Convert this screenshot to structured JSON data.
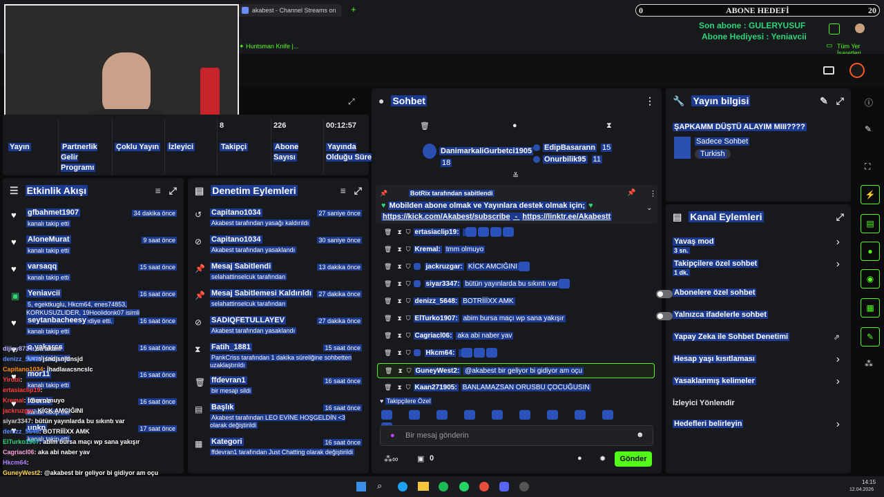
{
  "browser": {
    "tab_title": "akabest - Channel Streams on",
    "new_tab": "+",
    "bookmark": "Huntsman Knife |...",
    "all_bookmarks": "Tüm Yer İşaretleri"
  },
  "overlay": {
    "goal_left": "0",
    "goal_title": "ABONE HEDEFİ",
    "goal_right": "20",
    "last_sub": "Son abone : GULERYUSUF",
    "sub_gifter": "Abone Hediyesi : Yeniavcii"
  },
  "stats": {
    "items": [
      {
        "label": "Yayın",
        "value": ""
      },
      {
        "label": "Partnerlik Gelir Programı",
        "value": ""
      },
      {
        "label": "Çoklu Yayın",
        "value": ""
      },
      {
        "label": "İzleyici",
        "value": ""
      },
      {
        "label": "Takipçi",
        "value": "8"
      },
      {
        "label": "Abone Sayısı",
        "value": "226"
      },
      {
        "label": "Yayında Olduğu Süre",
        "value": "00:12:57"
      }
    ]
  },
  "activity": {
    "title": "Etkinlik Akışı",
    "items": [
      {
        "user": "gfbahmet1907",
        "desc": "kanalı takip etti",
        "time": "34 dakika önce"
      },
      {
        "user": "AloneMurat",
        "desc": "kanalı takip etti",
        "time": "9 saat önce"
      },
      {
        "user": "varsaqq",
        "desc": "kanalı takip etti",
        "time": "15 saat önce"
      },
      {
        "user": "Yeniavcii",
        "desc": "5, egektkuglu, Hkcm64, enes74853, KORKUSUZLIDER, 19Hoolidonk07 isimli kullanıcıya abonelik hediye etti.",
        "time": "16 saat önce"
      },
      {
        "user": "seytanbacheesy",
        "desc": "kanalı takip etti",
        "time": "16 saat önce"
      },
      {
        "user": "o.yakarcs",
        "desc": "kanalı takip etti",
        "time": "16 saat önce"
      },
      {
        "user": "mor11",
        "desc": "kanalı takip etti",
        "time": "16 saat önce"
      },
      {
        "user": "iGeme",
        "desc": "kanalı takip etti",
        "time": "16 saat önce"
      },
      {
        "user": "unkn",
        "desc": "kanalı takip etti",
        "time": "17 saat önce"
      }
    ]
  },
  "overlay_chat": [
    {
      "user": "dijiey8734",
      "msg": ": sa akam",
      "color": "#b7b7ff"
    },
    {
      "user": "denizz_5648",
      "msg": ": jsndjsnjdnsjd",
      "color": "#5b8cff"
    },
    {
      "user": "Capitano1034",
      "msg": ": İhadlaıacsncslc",
      "color": "#ff8a00"
    },
    {
      "user": "Yirobi",
      "msg": ":",
      "color": "#ff3b3b"
    },
    {
      "user": "ertasiaclip19",
      "msg": ":",
      "color": "#ff3b3b"
    },
    {
      "user": "Kremal",
      "msg": ": tmm olmuyo",
      "color": "#ff3b3b"
    },
    {
      "user": "jackruzgar",
      "msg": ": KİCK AMCIĞINI",
      "color": "#ff3b3b"
    },
    {
      "user": "siyar3347",
      "msg": ": bütün yayınlarda bu sıkıntı var",
      "color": "#cfcfcf"
    },
    {
      "user": "denizz_5648",
      "msg": ": BOTRİİİXX AMK",
      "color": "#5b8cff"
    },
    {
      "user": "ElTurko1907",
      "msg": ": abim bursa maçı wp sana yakışır",
      "color": "#2ed67a"
    },
    {
      "user": "Cagriacl06",
      "msg": ": aka abi naber yav",
      "color": "#ff9edb"
    },
    {
      "user": "Hkcm64",
      "msg": ":",
      "color": "#b07cff"
    },
    {
      "user": "GuneyWest2",
      "msg": ": @akabest bir geliyor bi gidiyor am oçu",
      "color": "#ffd54a"
    },
    {
      "user": "Kaan271905",
      "msg": ": BANLAMAZSAN ORUSBU ÇOCUĞUSIN",
      "color": "#ffffff"
    }
  ],
  "moderation": {
    "title": "Denetim Eylemleri",
    "items": [
      {
        "title": "Capitano1034",
        "desc": "Akabest tarafından yasağı kaldırıldı",
        "time": "27 saniye önce",
        "icon": "undo-icon"
      },
      {
        "title": "Capitano1034",
        "desc": "Akabest tarafından yasaklandı",
        "time": "30 saniye önce",
        "icon": "ban-icon"
      },
      {
        "title": "Mesaj Sabitlendi",
        "desc": "selahattinselcuk tarafından",
        "time": "13 dakika önce",
        "icon": "pin-icon"
      },
      {
        "title": "Mesaj Sabitlemesi Kaldırıldı",
        "desc": "selahattinselcuk tarafından",
        "time": "27 dakika önce",
        "icon": "unpin-icon"
      },
      {
        "title": "SADIQFETULLAYEV",
        "desc": "Akabest tarafından yasaklandı",
        "time": "27 dakika önce",
        "icon": "ban-icon"
      },
      {
        "title": "Fatih_1881",
        "desc": "PankCriss tarafından 1 dakika süreliğine sohbetten uzaklaştırıldı",
        "time": "15 saat önce",
        "icon": "hourglass-icon"
      },
      {
        "title": "ffdevran1",
        "desc": "bir mesajı sildi",
        "time": "16 saat önce",
        "icon": "trash-icon"
      },
      {
        "title": "Başlık",
        "desc": "Akabest tarafından LEO EVİNE HOŞGELDİN <3 olarak değiştirildi",
        "time": "16 saat önce",
        "icon": "title-icon"
      },
      {
        "title": "Kategori",
        "desc": "ffdevran1 tarafından Just Chatting olarak değiştirildi",
        "time": "16 saat önce",
        "icon": "category-icon"
      }
    ]
  },
  "chat": {
    "title": "Sohbet",
    "top_users": [
      {
        "name": "DanimarkaliGurbetci1905",
        "count": "18"
      },
      {
        "name": "EdipBasarann",
        "count": "15"
      },
      {
        "name": "Onurbilik95",
        "count": "11"
      }
    ],
    "pinned": {
      "by": "BotRix tarafından sabitlendi",
      "text": "Mobilden abone olmak ve Yayınlara destek olmak için;",
      "link1": "https://kick.com/Akabest/subscribe",
      "sep": " - ",
      "link2": "https://linktr.ee/Akabestt"
    },
    "messages": [
      {
        "user": "ertasiaclip19:",
        "msg": "",
        "emotes": 4
      },
      {
        "user": "Kremal:",
        "msg": "tmm olmuyo",
        "emotes": 0
      },
      {
        "user": "jackruzgar:",
        "msg": "KİCK AMCIĞINI",
        "emotes": 1
      },
      {
        "user": "siyar3347:",
        "msg": "bütün yayınlarda bu sıkıntı var",
        "emotes": 1
      },
      {
        "user": "denizz_5648:",
        "msg": "BOTRİİİXX AMK",
        "emotes": 0
      },
      {
        "user": "ElTurko1907:",
        "msg": "abim bursa maçı wp sana yakışır",
        "emotes": 0
      },
      {
        "user": "Cagriacl06:",
        "msg": "aka abi naber yav",
        "emotes": 0
      },
      {
        "user": "Hkcm64:",
        "msg": "",
        "emotes": 3
      },
      {
        "user": "GuneyWest2:",
        "msg": "@akabest bir geliyor bi gidiyor am oçu",
        "emotes": 0
      },
      {
        "user": "Kaan271905:",
        "msg": "BANLAMAZSAN ORUSBU ÇOCUĞUSIN",
        "emotes": 0
      }
    ],
    "followers_only": "Takipçilere Özel",
    "input_placeholder": "Bir mesaj gönderin",
    "points": "0",
    "send": "Gönder"
  },
  "stream_info": {
    "title": "Yayın bilgisi",
    "stream_title": "ŞAPKAMM DÜŞTÜ ALAYIM MIII????",
    "category": "Sadece Sohbet",
    "language": "Turkish"
  },
  "channel_actions": {
    "title": "Kanal Eylemleri",
    "items": [
      {
        "label": "Yavaş mod",
        "sub": "3 sn.",
        "ctrl": "chevron"
      },
      {
        "label": "Takipçilere özel sohbet",
        "sub": "1 dk.",
        "ctrl": "chevron"
      },
      {
        "label": "Abonelere özel sohbet",
        "sub": "",
        "ctrl": "toggle"
      },
      {
        "label": "Yalnızca ifadelerle sohbet",
        "sub": "",
        "ctrl": "toggle"
      },
      {
        "label": "Yapay Zeka ile Sohbet Denetimi",
        "sub": "",
        "ctrl": "external"
      },
      {
        "label": "Hesap yaşı kısıtlaması",
        "sub": "",
        "ctrl": "chevron"
      },
      {
        "label": "Yasaklanmış kelimeler",
        "sub": "",
        "ctrl": "chevron"
      },
      {
        "label": "İzleyici Yönlendir",
        "sub": "",
        "ctrl": "none"
      },
      {
        "label": "Hedefleri belirleyin",
        "sub": "",
        "ctrl": "chevron"
      }
    ]
  },
  "taskbar": {
    "time": "14:15",
    "date": "12.04.2026"
  }
}
